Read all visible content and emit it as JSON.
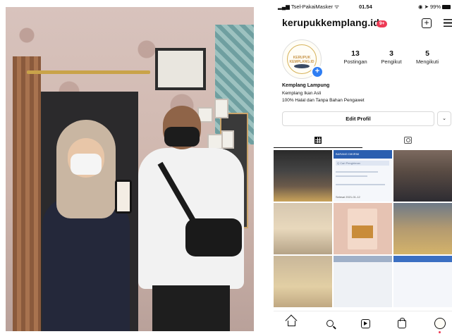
{
  "status_bar": {
    "carrier": "Tsel-PakaiMasker",
    "time": "01.54",
    "battery": "99%"
  },
  "profile": {
    "username": "kerupukkemplang.id",
    "notification_badge": "9+",
    "avatar_text": "KERUPUK KEMPLANG.ID",
    "stats": [
      {
        "value": "13",
        "label": "Postingan"
      },
      {
        "value": "3",
        "label": "Pengikut"
      },
      {
        "value": "5",
        "label": "Mengikuti"
      }
    ],
    "bio": {
      "name": "Kemplang Lampung",
      "lines": [
        "Kemplang Ikan Asli",
        "100% Halal dan Tanpa Bahan Pengawet"
      ]
    },
    "edit_button": "Edit Profil",
    "dropdown_glyph": "⌄"
  },
  "tabs": [
    {
      "icon": "grid-icon",
      "active": true
    },
    {
      "icon": "tagged-icon",
      "active": false
    }
  ],
  "posts": {
    "thumb2_header": "BARANG DIKIRIM",
    "thumb2_search": "Q  Cari Pengiriman",
    "thumb2_footer": "Selesai  2021-01-12"
  },
  "bottom_nav": [
    {
      "icon": "home-icon"
    },
    {
      "icon": "search-icon"
    },
    {
      "icon": "reels-icon"
    },
    {
      "icon": "shop-icon"
    },
    {
      "icon": "profile-icon"
    }
  ],
  "colors": {
    "badge_red": "#ed3a55",
    "add_blue": "#2f7ef3"
  }
}
